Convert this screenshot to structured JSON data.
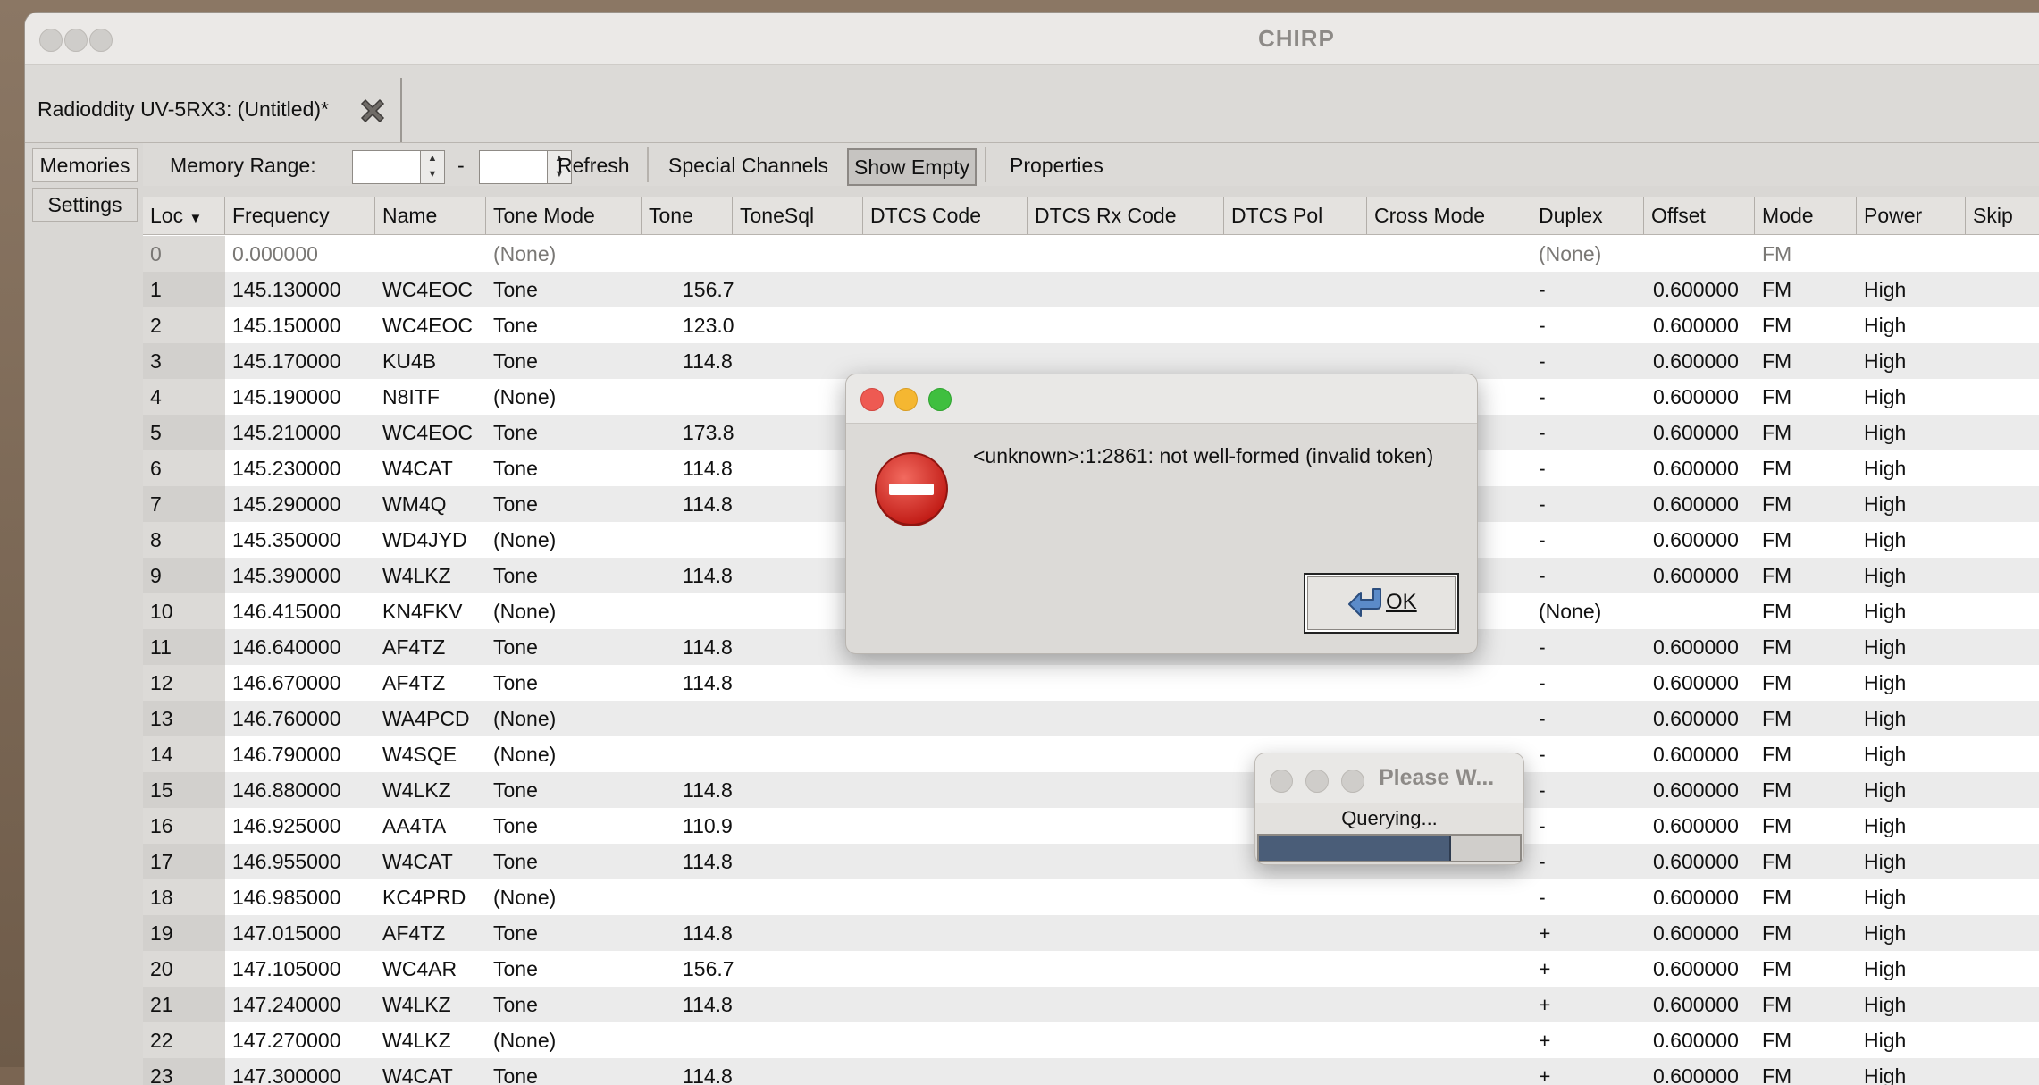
{
  "window": {
    "title": "CHIRP"
  },
  "document_tab": {
    "label": "Radioddity UV-5RX3: (Untitled)*"
  },
  "side_tabs": {
    "memories": "Memories",
    "settings": "Settings"
  },
  "toolbar": {
    "memory_range_label": "Memory Range:",
    "range_dash": "-",
    "refresh": "Refresh",
    "special_channels": "Special Channels",
    "show_empty": "Show Empty",
    "properties": "Properties"
  },
  "columns": [
    "Loc",
    "Frequency",
    "Name",
    "Tone Mode",
    "Tone",
    "ToneSql",
    "DTCS Code",
    "DTCS Rx Code",
    "DTCS Pol",
    "Cross Mode",
    "Duplex",
    "Offset",
    "Mode",
    "Power",
    "Skip"
  ],
  "rows": [
    {
      "loc": "0",
      "freq": "0.000000",
      "name": "",
      "tmode": "(None)",
      "tone": "",
      "duplex": "(None)",
      "offset": "",
      "mode": "FM",
      "power": "",
      "empty": true
    },
    {
      "loc": "1",
      "freq": "145.130000",
      "name": "WC4EOC",
      "tmode": "Tone",
      "tone": "156.7",
      "duplex": "-",
      "offset": "0.600000",
      "mode": "FM",
      "power": "High"
    },
    {
      "loc": "2",
      "freq": "145.150000",
      "name": "WC4EOC",
      "tmode": "Tone",
      "tone": "123.0",
      "duplex": "-",
      "offset": "0.600000",
      "mode": "FM",
      "power": "High"
    },
    {
      "loc": "3",
      "freq": "145.170000",
      "name": "KU4B",
      "tmode": "Tone",
      "tone": "114.8",
      "duplex": "-",
      "offset": "0.600000",
      "mode": "FM",
      "power": "High"
    },
    {
      "loc": "4",
      "freq": "145.190000",
      "name": "N8ITF",
      "tmode": "(None)",
      "tone": "",
      "duplex": "-",
      "offset": "0.600000",
      "mode": "FM",
      "power": "High"
    },
    {
      "loc": "5",
      "freq": "145.210000",
      "name": "WC4EOC",
      "tmode": "Tone",
      "tone": "173.8",
      "duplex": "-",
      "offset": "0.600000",
      "mode": "FM",
      "power": "High"
    },
    {
      "loc": "6",
      "freq": "145.230000",
      "name": "W4CAT",
      "tmode": "Tone",
      "tone": "114.8",
      "duplex": "-",
      "offset": "0.600000",
      "mode": "FM",
      "power": "High"
    },
    {
      "loc": "7",
      "freq": "145.290000",
      "name": "WM4Q",
      "tmode": "Tone",
      "tone": "114.8",
      "duplex": "-",
      "offset": "0.600000",
      "mode": "FM",
      "power": "High"
    },
    {
      "loc": "8",
      "freq": "145.350000",
      "name": "WD4JYD",
      "tmode": "(None)",
      "tone": "",
      "duplex": "-",
      "offset": "0.600000",
      "mode": "FM",
      "power": "High"
    },
    {
      "loc": "9",
      "freq": "145.390000",
      "name": "W4LKZ",
      "tmode": "Tone",
      "tone": "114.8",
      "duplex": "-",
      "offset": "0.600000",
      "mode": "FM",
      "power": "High"
    },
    {
      "loc": "10",
      "freq": "146.415000",
      "name": "KN4FKV",
      "tmode": "(None)",
      "tone": "",
      "duplex": "(None)",
      "offset": "",
      "mode": "FM",
      "power": "High"
    },
    {
      "loc": "11",
      "freq": "146.640000",
      "name": "AF4TZ",
      "tmode": "Tone",
      "tone": "114.8",
      "duplex": "-",
      "offset": "0.600000",
      "mode": "FM",
      "power": "High"
    },
    {
      "loc": "12",
      "freq": "146.670000",
      "name": "AF4TZ",
      "tmode": "Tone",
      "tone": "114.8",
      "duplex": "-",
      "offset": "0.600000",
      "mode": "FM",
      "power": "High"
    },
    {
      "loc": "13",
      "freq": "146.760000",
      "name": "WA4PCD",
      "tmode": "(None)",
      "tone": "",
      "duplex": "-",
      "offset": "0.600000",
      "mode": "FM",
      "power": "High"
    },
    {
      "loc": "14",
      "freq": "146.790000",
      "name": "W4SQE",
      "tmode": "(None)",
      "tone": "",
      "duplex": "-",
      "offset": "0.600000",
      "mode": "FM",
      "power": "High"
    },
    {
      "loc": "15",
      "freq": "146.880000",
      "name": "W4LKZ",
      "tmode": "Tone",
      "tone": "114.8",
      "duplex": "-",
      "offset": "0.600000",
      "mode": "FM",
      "power": "High"
    },
    {
      "loc": "16",
      "freq": "146.925000",
      "name": "AA4TA",
      "tmode": "Tone",
      "tone": "110.9",
      "duplex": "-",
      "offset": "0.600000",
      "mode": "FM",
      "power": "High"
    },
    {
      "loc": "17",
      "freq": "146.955000",
      "name": "W4CAT",
      "tmode": "Tone",
      "tone": "114.8",
      "duplex": "-",
      "offset": "0.600000",
      "mode": "FM",
      "power": "High"
    },
    {
      "loc": "18",
      "freq": "146.985000",
      "name": "KC4PRD",
      "tmode": "(None)",
      "tone": "",
      "duplex": "-",
      "offset": "0.600000",
      "mode": "FM",
      "power": "High"
    },
    {
      "loc": "19",
      "freq": "147.015000",
      "name": "AF4TZ",
      "tmode": "Tone",
      "tone": "114.8",
      "duplex": "+",
      "offset": "0.600000",
      "mode": "FM",
      "power": "High"
    },
    {
      "loc": "20",
      "freq": "147.105000",
      "name": "WC4AR",
      "tmode": "Tone",
      "tone": "156.7",
      "duplex": "+",
      "offset": "0.600000",
      "mode": "FM",
      "power": "High"
    },
    {
      "loc": "21",
      "freq": "147.240000",
      "name": "W4LKZ",
      "tmode": "Tone",
      "tone": "114.8",
      "duplex": "+",
      "offset": "0.600000",
      "mode": "FM",
      "power": "High"
    },
    {
      "loc": "22",
      "freq": "147.270000",
      "name": "W4LKZ",
      "tmode": "(None)",
      "tone": "",
      "duplex": "+",
      "offset": "0.600000",
      "mode": "FM",
      "power": "High"
    },
    {
      "loc": "23",
      "freq": "147.300000",
      "name": "W4CAT",
      "tmode": "Tone",
      "tone": "114.8",
      "duplex": "+",
      "offset": "0.600000",
      "mode": "FM",
      "power": "High"
    }
  ],
  "error_dialog": {
    "message": "<unknown>:1:2861: not well-formed (invalid token)",
    "ok_label": "OK",
    "icon": "error-stop-icon"
  },
  "progress_dialog": {
    "title": "Please W...",
    "status": "Querying...",
    "progress_fraction": 0.73
  },
  "colors": {
    "accent_progress": "#4a5d78",
    "error_red": "#d8322c",
    "close_dot": "#ee5a52",
    "minimize_dot": "#f5b731",
    "zoom_dot": "#3fbf3f"
  }
}
